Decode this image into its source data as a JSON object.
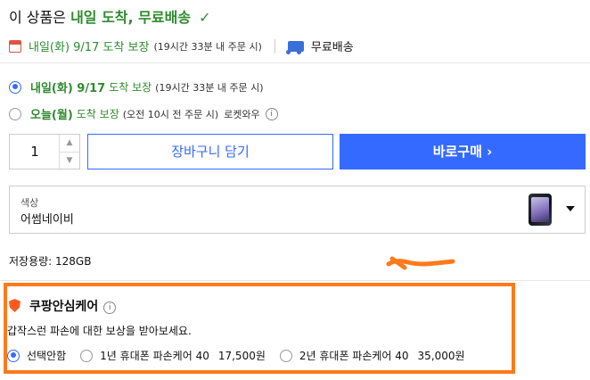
{
  "header": {
    "prefix": "이 상품은",
    "highlight": "내일 도착, 무료배송",
    "check_icon": "check-icon"
  },
  "delivery_info": {
    "date_text": "내일(화) 9/17 도착 보장",
    "note": "(19시간 33분 내 주문 시)",
    "shipping": "무료배송"
  },
  "options": [
    {
      "date": "내일(화) 9/17",
      "label": "도착 보장",
      "note": "(19시간 33분 내 주문 시)",
      "selected": true
    },
    {
      "date": "오늘(월)",
      "label": "도착 보장",
      "note": "(오전 10시 전 주문 시)",
      "extra": "로켓와우",
      "selected": false
    }
  ],
  "purchase": {
    "quantity": "1",
    "cart_label": "장바구니 담기",
    "buy_label": "바로구매 ›"
  },
  "color_select": {
    "label": "색상",
    "value": "어썸네이비"
  },
  "storage": {
    "text": "저장용량: 128GB"
  },
  "care": {
    "title": "쿠팡안심케어",
    "description": "갑작스런 파손에 대한 보상을 받아보세요.",
    "choices": [
      {
        "label": "선택안함",
        "price": "",
        "selected": true
      },
      {
        "label": "1년 휴대폰 파손케어 40",
        "price": "17,500원",
        "selected": false
      },
      {
        "label": "2년 휴대폰 파손케어 40",
        "price": "35,000원",
        "selected": false
      }
    ]
  },
  "colors": {
    "accent": "#346aff",
    "green": "#2e8b2e",
    "highlight_box": "#ff7a1a"
  }
}
